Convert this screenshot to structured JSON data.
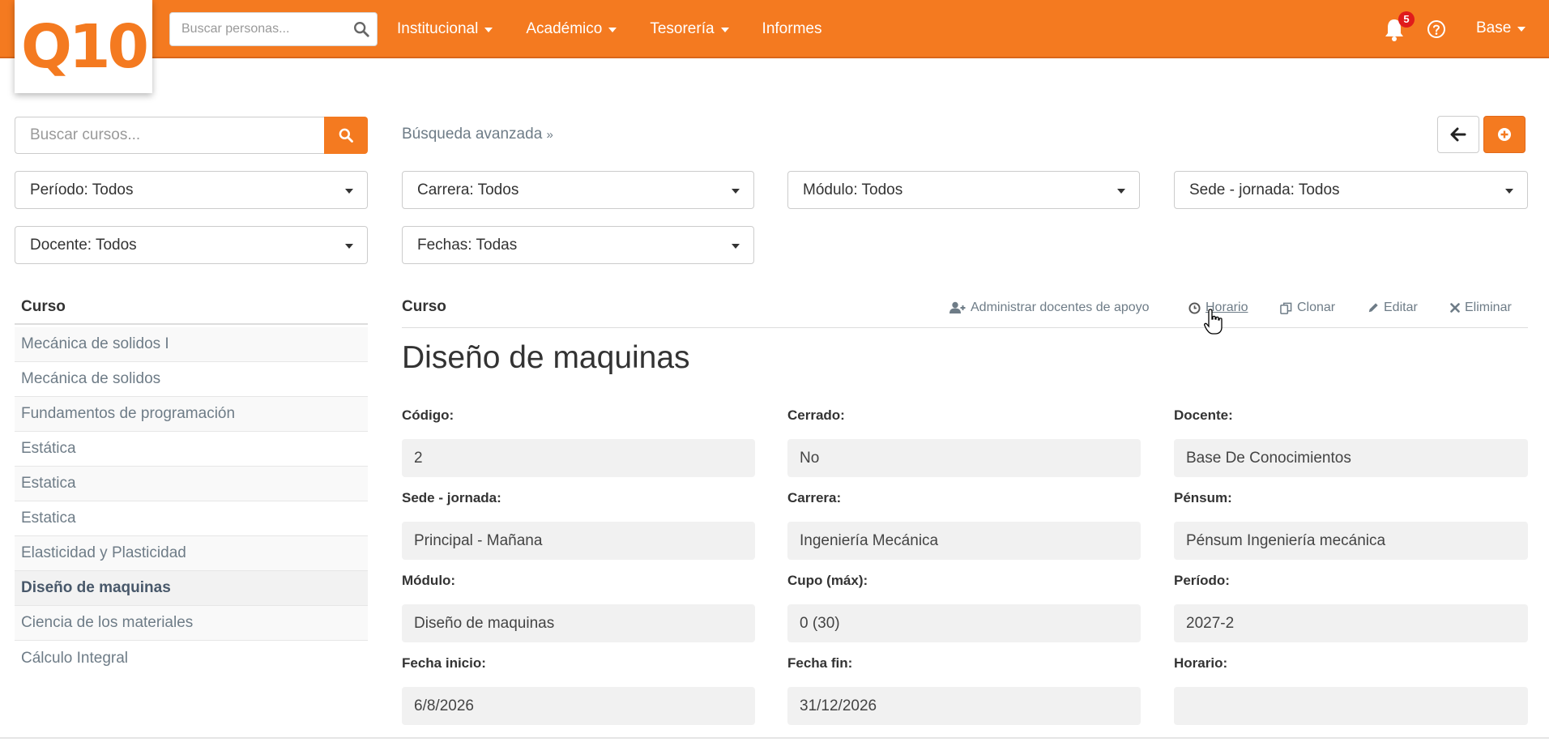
{
  "navbar": {
    "logo": "Q10",
    "search_placeholder": "Buscar personas...",
    "menu": [
      {
        "label": "Institucional",
        "dropdown": true
      },
      {
        "label": "Académico",
        "dropdown": true
      },
      {
        "label": "Tesorería",
        "dropdown": true
      },
      {
        "label": "Informes",
        "dropdown": false
      }
    ],
    "notifications_count": "5",
    "user_label": "Base",
    "accent_color": "#f47a20"
  },
  "filters": {
    "course_search_placeholder": "Buscar cursos...",
    "advanced_search_label": "Búsqueda avanzada",
    "periodo": "Período: Todos",
    "carrera": "Carrera: Todos",
    "modulo": "Módulo: Todos",
    "sede_jornada": "Sede - jornada: Todos",
    "docente": "Docente: Todos",
    "fechas": "Fechas: Todas"
  },
  "course_list": {
    "header": "Curso",
    "items": [
      "Mecánica de solidos I",
      "Mecánica de solidos",
      "Fundamentos de programación",
      "Estática",
      "Estatica",
      "Estatica",
      "Elasticidad y Plasticidad",
      "Diseño de maquinas",
      "Ciencia de los materiales",
      "Cálculo Integral"
    ],
    "active_index": 7
  },
  "detail": {
    "header_label": "Curso",
    "actions": {
      "docentes_apoyo": "Administrar docentes de apoyo",
      "horario": "Horario",
      "clonar": "Clonar",
      "editar": "Editar",
      "eliminar": "Eliminar"
    },
    "title": "Diseño de maquinas",
    "fields": {
      "codigo": {
        "label": "Código:",
        "value": "2"
      },
      "cerrado": {
        "label": "Cerrado:",
        "value": "No"
      },
      "docente": {
        "label": "Docente:",
        "value": "Base De Conocimientos"
      },
      "sede": {
        "label": "Sede - jornada:",
        "value": "Principal - Mañana"
      },
      "carrera": {
        "label": "Carrera:",
        "value": "Ingeniería Mecánica"
      },
      "pensum": {
        "label": "Pénsum:",
        "value": "Pénsum Ingeniería mecánica"
      },
      "modulo": {
        "label": "Módulo:",
        "value": "Diseño de maquinas"
      },
      "cupo": {
        "label": "Cupo (máx):",
        "value": "0 (30)"
      },
      "periodo": {
        "label": "Período:",
        "value": "2027-2"
      },
      "fecha_inicio": {
        "label": "Fecha inicio:",
        "value": "6/8/2026"
      },
      "fecha_fin": {
        "label": "Fecha fin:",
        "value": "31/12/2026"
      },
      "horario": {
        "label": "Horario:",
        "value": ""
      }
    }
  }
}
